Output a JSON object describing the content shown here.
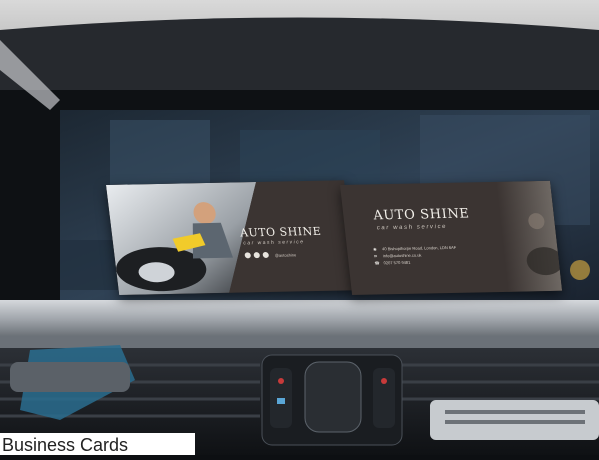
{
  "caption": "Business Cards",
  "card_front": {
    "brand": "AUTO SHINE",
    "tagline": "car wash service",
    "handle": "@autoshine"
  },
  "card_back": {
    "brand": "AUTO SHINE",
    "tagline": "car wash service",
    "address": "40 Bishopthorpe Road, London, LDN 6AF",
    "email": "info@autoshine.co.uk",
    "phone": "0207 570 9481"
  },
  "colors": {
    "card": "#3b3432",
    "dashboard": "#1c1f24",
    "screen": "#2a3a4a"
  }
}
